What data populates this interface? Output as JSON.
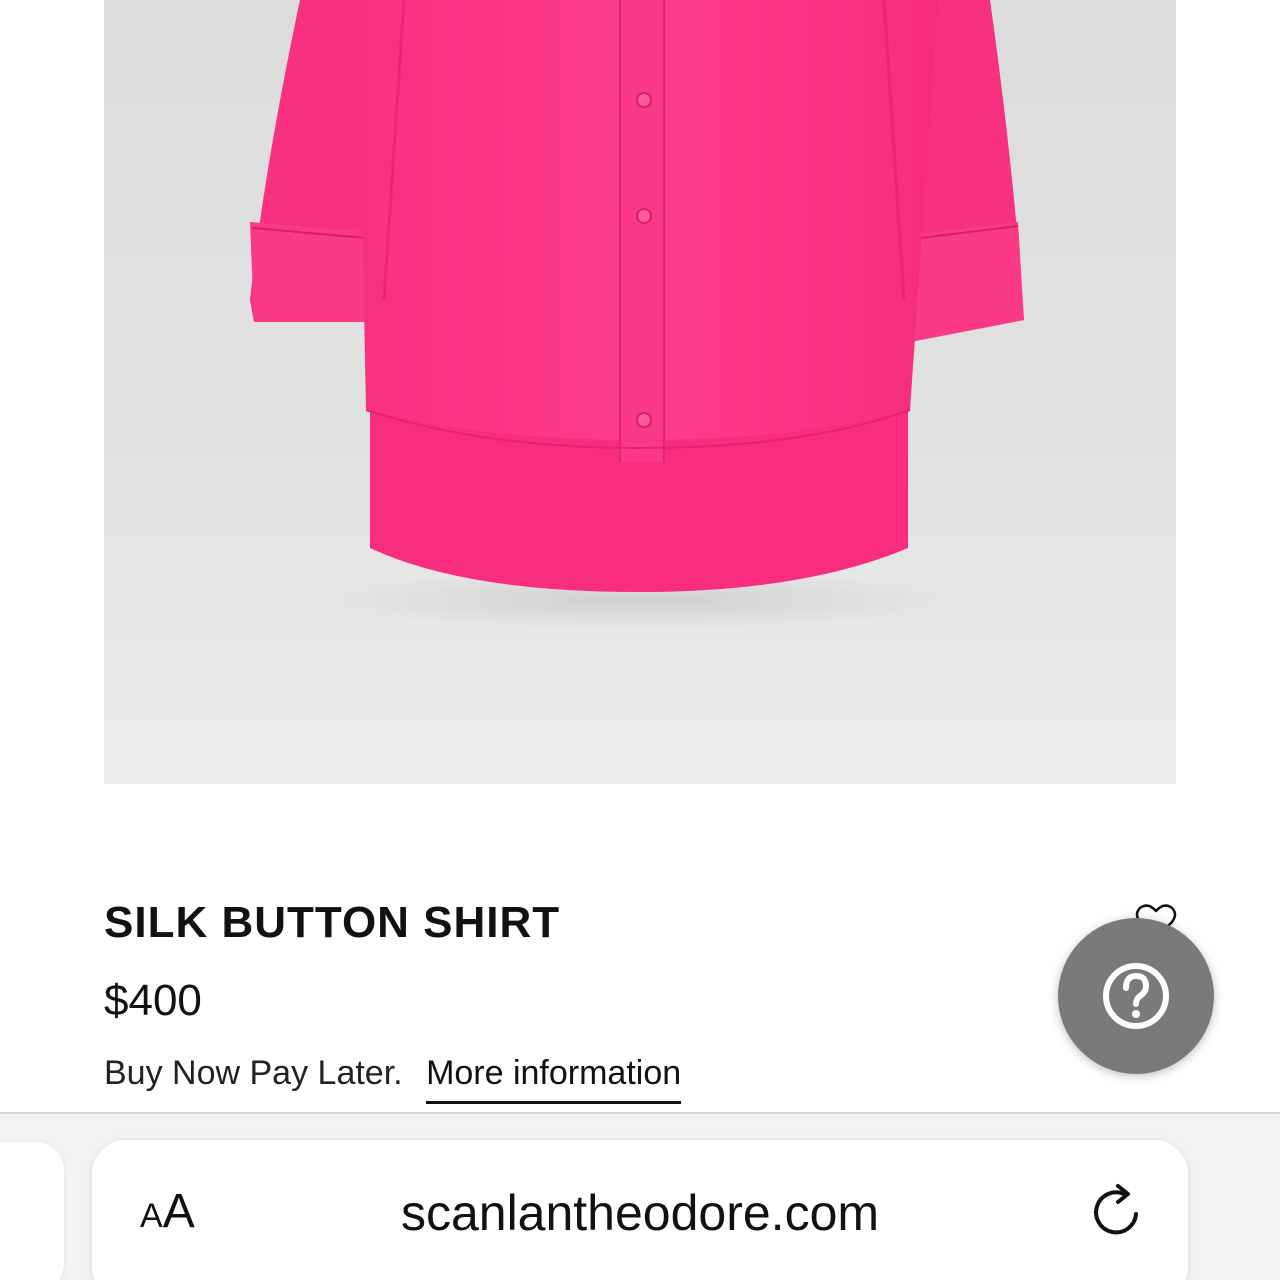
{
  "product": {
    "title": "SILK BUTTON SHIRT",
    "price": "$400",
    "bnpl_text": "Buy Now Pay Later.",
    "bnpl_link": "More information",
    "image_icon": "pink-silk-shirt-image",
    "favorite_icon": "heart-outline-icon"
  },
  "help_widget": {
    "icon": "question-circle-icon",
    "color": "#7a7a7a"
  },
  "browser": {
    "reader_label_small": "A",
    "reader_label_large": "A",
    "url": "scanlantheodore.com",
    "reload_icon": "reload-icon"
  },
  "colors": {
    "shirt": "#ff2f85",
    "image_background": "#e0e0e0",
    "text": "#111111"
  }
}
